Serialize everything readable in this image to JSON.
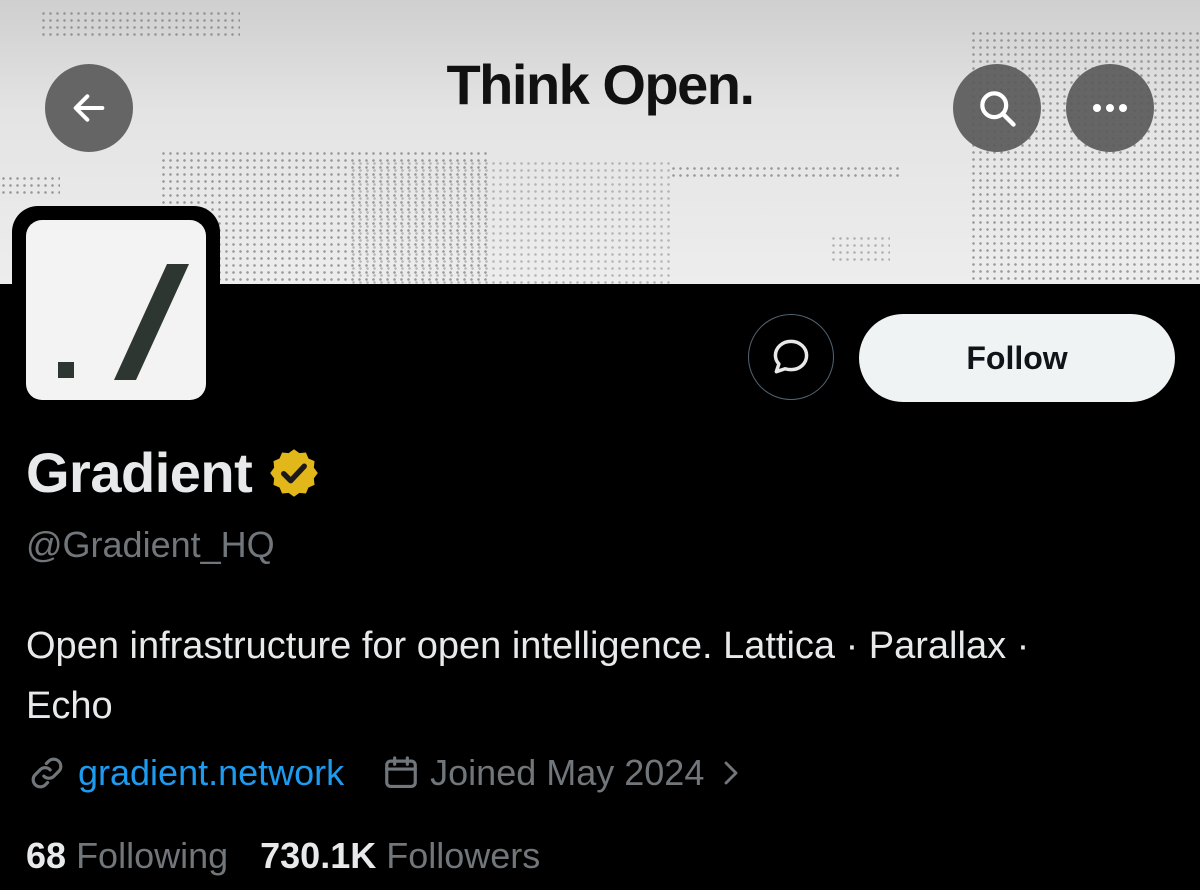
{
  "banner": {
    "title": "Think Open."
  },
  "profile": {
    "name": "Gradient",
    "handle": "@Gradient_HQ",
    "bio": "Open infrastructure for open intelligence. Lattica · Parallax · Echo",
    "website": "gradient.network",
    "joined": "Joined May 2024",
    "verified_badge_color": "#e2b719"
  },
  "actions": {
    "follow_label": "Follow"
  },
  "stats": {
    "following_count": "68",
    "following_label": "Following",
    "followers_count": "730.1K",
    "followers_label": "Followers"
  },
  "colors": {
    "link": "#1d9bf0",
    "muted": "#71767b",
    "text": "#e7e9ea"
  }
}
